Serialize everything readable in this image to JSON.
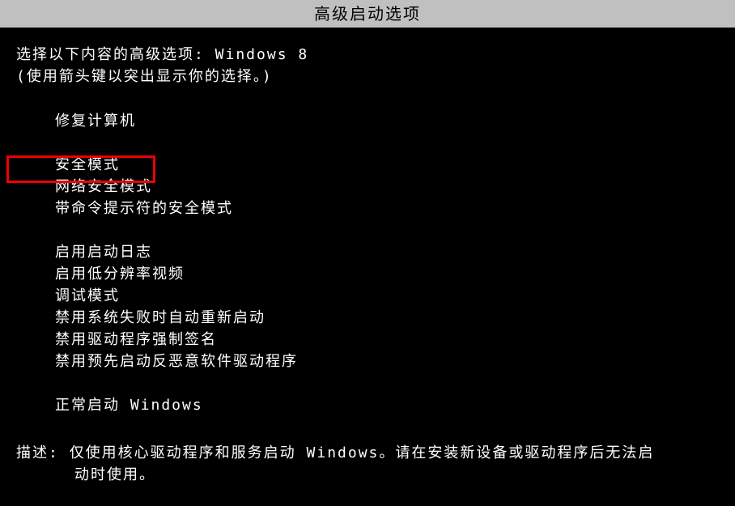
{
  "title": "高级启动选项",
  "intro_line1": "选择以下内容的高级选项:  Windows 8",
  "intro_line2": "(使用箭头键以突出显示你的选择。)",
  "menu": {
    "group1": [
      "修复计算机"
    ],
    "group2": [
      "安全模式",
      "网络安全模式",
      "带命令提示符的安全模式"
    ],
    "group3": [
      "启用启动日志",
      "启用低分辨率视频",
      "调试模式",
      "禁用系统失败时自动重新启动",
      "禁用驱动程序强制签名",
      "禁用预先启动反恶意软件驱动程序"
    ],
    "group4": [
      "正常启动 Windows"
    ]
  },
  "description": {
    "label": "描述:",
    "text_line1": "仅使用核心驱动程序和服务启动 Windows。请在安装新设备或驱动程序后无法启",
    "text_line2": "动时使用。"
  },
  "highlighted_item": "安全模式"
}
